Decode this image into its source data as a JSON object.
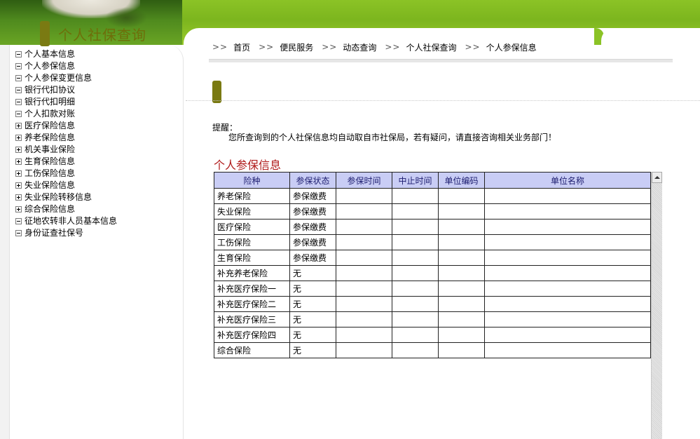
{
  "breadcrumb": {
    "separator": ">>",
    "items": [
      "首页",
      "便民服务",
      "动态查询",
      "个人社保查询",
      "个人参保信息"
    ]
  },
  "sidebar": {
    "title": "个人社保查询",
    "items": [
      {
        "label": "个人基本信息",
        "expand": "minus"
      },
      {
        "label": "个人参保信息",
        "expand": "minus"
      },
      {
        "label": "个人参保变更信息",
        "expand": "minus"
      },
      {
        "label": "银行代扣协议",
        "expand": "minus"
      },
      {
        "label": "银行代扣明细",
        "expand": "minus"
      },
      {
        "label": "个人扣款对账",
        "expand": "minus"
      },
      {
        "label": "医疗保险信息",
        "expand": "plus"
      },
      {
        "label": "养老保险信息",
        "expand": "plus"
      },
      {
        "label": "机关事业保险",
        "expand": "plus"
      },
      {
        "label": "生育保险信息",
        "expand": "plus"
      },
      {
        "label": "工伤保险信息",
        "expand": "plus"
      },
      {
        "label": "失业保险信息",
        "expand": "plus"
      },
      {
        "label": "失业保险转移信息",
        "expand": "plus"
      },
      {
        "label": "综合保险信息",
        "expand": "plus"
      },
      {
        "label": "征地农转非人员基本信息",
        "expand": "minus"
      },
      {
        "label": "身份证查社保号",
        "expand": "minus"
      }
    ]
  },
  "notice": {
    "title": "提醒：",
    "text": "您所查询到的个人社保信息均自动取自市社保局，若有疑问，请直接咨询相关业务部门！"
  },
  "section_title": "个人参保信息",
  "table": {
    "columns": [
      "险种",
      "参保状态",
      "参保时间",
      "中止时间",
      "单位编码",
      "单位名称"
    ],
    "rows": [
      [
        "养老保险",
        "参保缴费",
        "",
        "",
        "",
        ""
      ],
      [
        "失业保险",
        "参保缴费",
        "",
        "",
        "",
        ""
      ],
      [
        "医疗保险",
        "参保缴费",
        "",
        "",
        "",
        ""
      ],
      [
        "工伤保险",
        "参保缴费",
        "",
        "",
        "",
        ""
      ],
      [
        "生育保险",
        "参保缴费",
        "",
        "",
        "",
        ""
      ],
      [
        "补充养老保险",
        "无",
        "",
        "",
        "",
        ""
      ],
      [
        "补充医疗保险一",
        "无",
        "",
        "",
        "",
        ""
      ],
      [
        "补充医疗保险二",
        "无",
        "",
        "",
        "",
        ""
      ],
      [
        "补充医疗保险三",
        "无",
        "",
        "",
        "",
        ""
      ],
      [
        "补充医疗保险四",
        "无",
        "",
        "",
        "",
        ""
      ],
      [
        "综合保险",
        "无",
        "",
        "",
        "",
        ""
      ]
    ]
  },
  "colors": {
    "header_green": "#8bc326",
    "sidebar_title": "#6e6e0a",
    "section_title": "#b01b1b",
    "table_header_bg": "#c9cdf5"
  }
}
